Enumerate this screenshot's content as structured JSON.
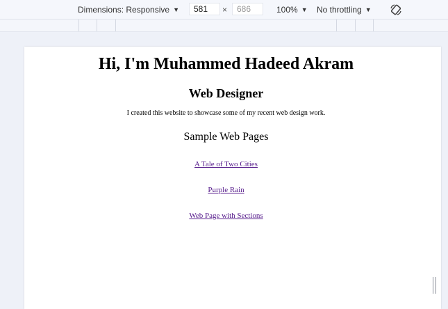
{
  "devtools": {
    "dimensions_label": "Dimensions: Responsive",
    "width_value": "581",
    "height_value": "686",
    "times": "×",
    "zoom": "100%",
    "throttling": "No throttling",
    "rotate_icon": "rotate-icon"
  },
  "page": {
    "title": "Hi, I'm Muhammed Hadeed Akram",
    "subtitle": "Web Designer",
    "intro": "I created this website to showcase some of my recent web design work.",
    "samples_heading": "Sample Web Pages",
    "links": [
      "A Tale of Two Cities",
      "Purple Rain",
      "Web Page with Sections"
    ],
    "link_color": "#551a8b"
  }
}
